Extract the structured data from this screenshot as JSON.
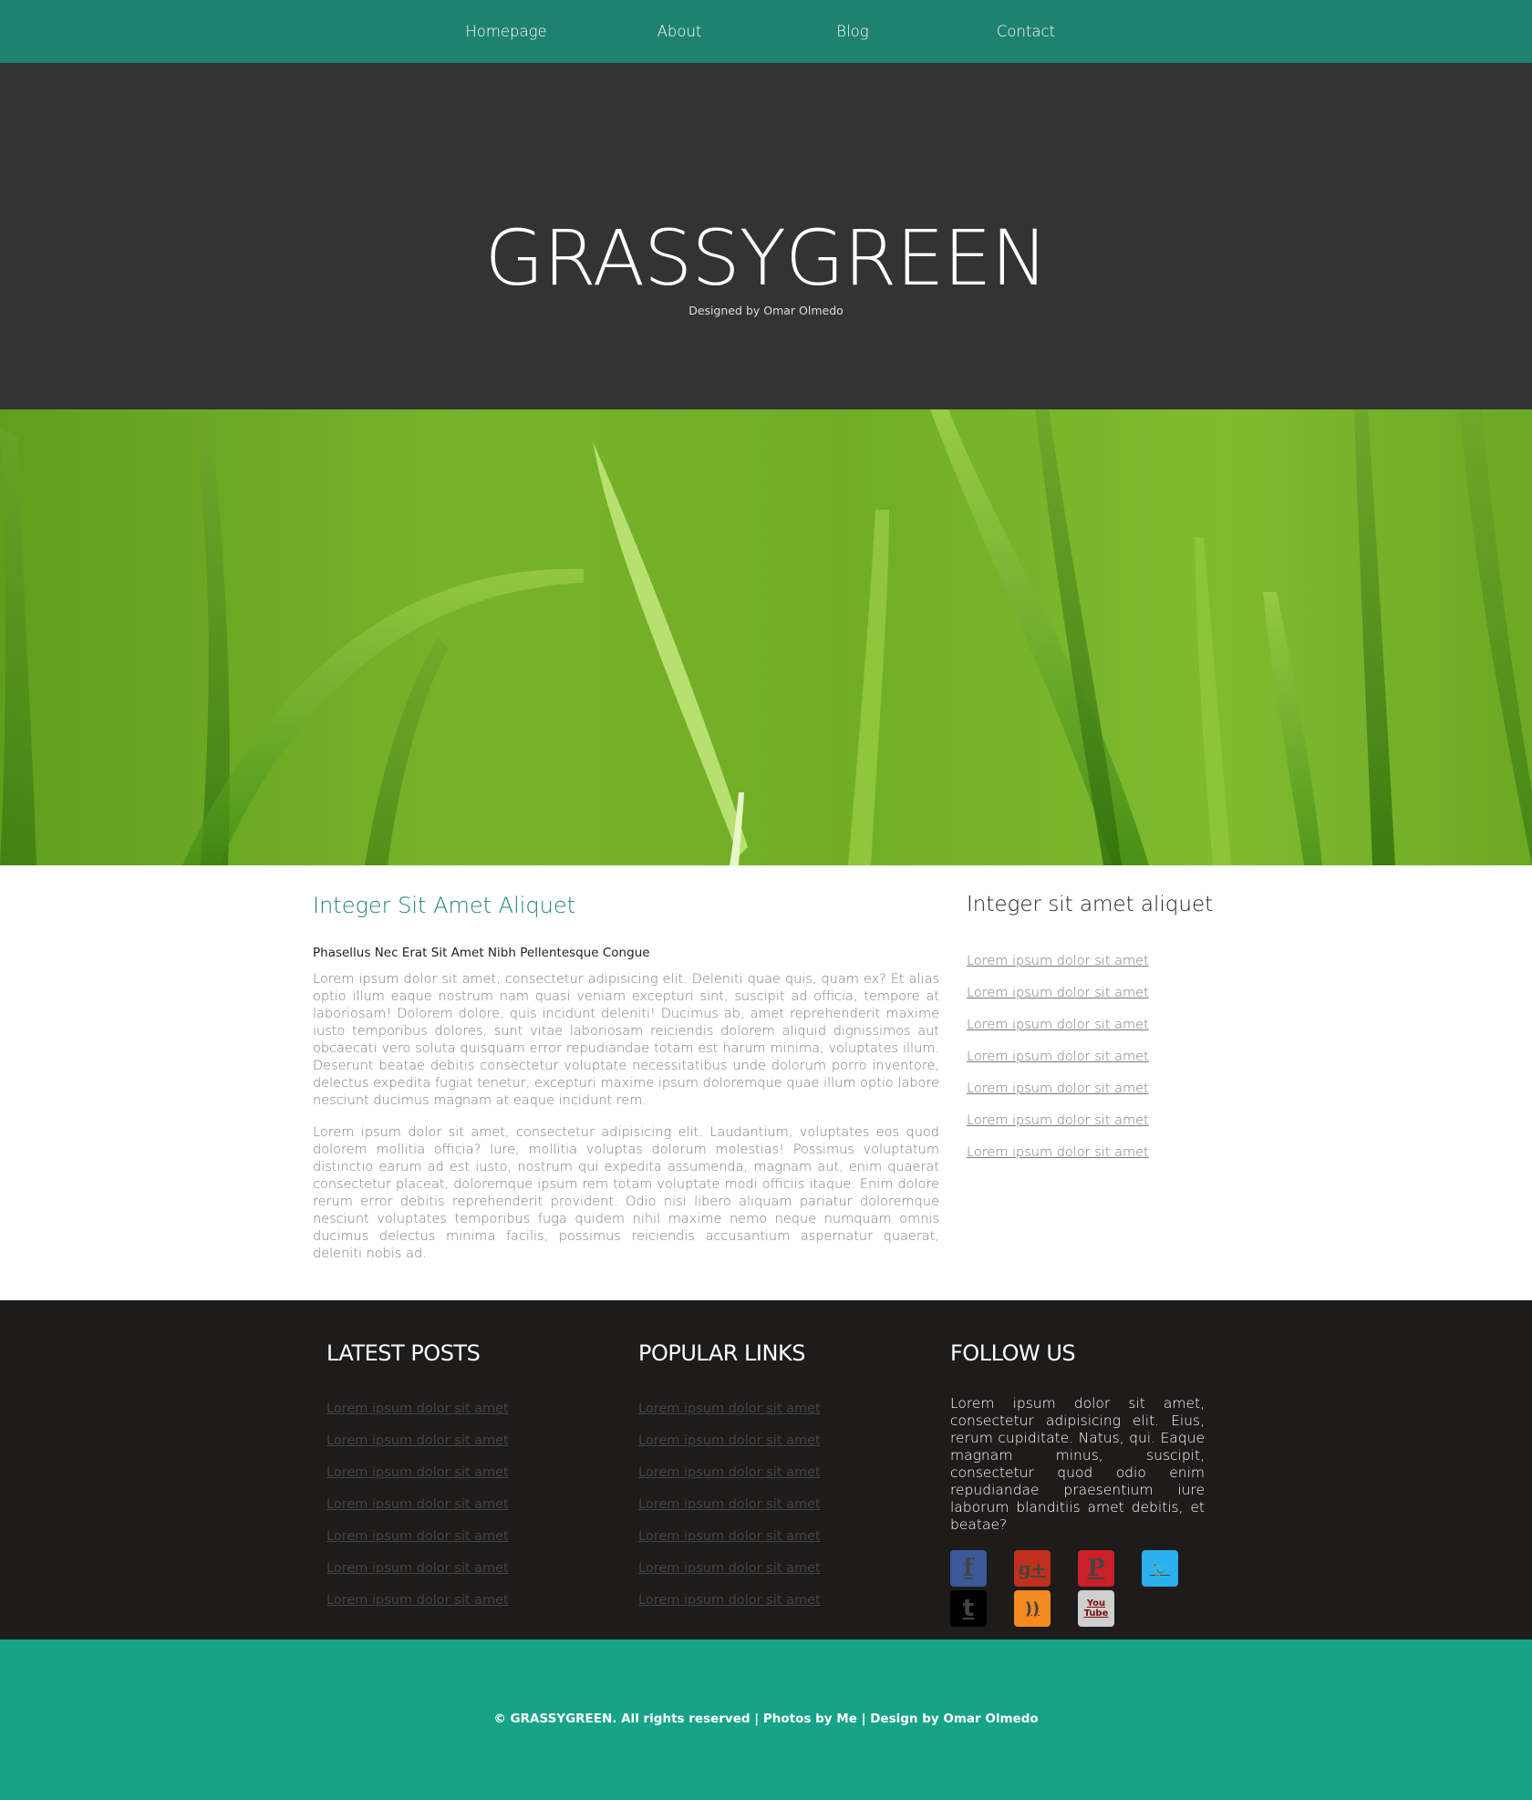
{
  "nav": {
    "items": [
      {
        "label": "Homepage"
      },
      {
        "label": "About"
      },
      {
        "label": "Blog"
      },
      {
        "label": "Contact"
      }
    ]
  },
  "header": {
    "title": "GRASSYGREEN",
    "subtitle": "Designed by Omar Olmedo"
  },
  "main": {
    "heading": "Integer Sit Amet Aliquet",
    "subheading": "Phasellus Nec Erat Sit Amet Nibh Pellentesque Congue",
    "paragraphs": [
      "Lorem ipsum dolor sit amet, consectetur adipisicing elit. Deleniti quae quis, quam ex? Et alias optio illum eaque nostrum nam quasi veniam excepturi sint, suscipit ad officia, tempore at laboriosam! Dolorem dolore, quis incidunt deleniti! Ducimus ab, amet reprehenderit maxime iusto temporibus dolores, sunt vitae laboriosam reiciendis dolorem aliquid dignissimos aut obcaecati vero soluta quisquam error repudiandae totam est harum minima, voluptates illum. Deserunt beatae debitis consectetur voluptate necessitatibus unde dolorum porro inventore, delectus expedita fugiat tenetur, excepturi maxime ipsum doloremque quae illum optio labore nesciunt ducimus magnam at eaque incidunt rem.",
      "Lorem ipsum dolor sit amet, consectetur adipisicing elit. Laudantium, voluptates eos quod dolorem mollitia officia? Iure, mollitia voluptas dolorum molestias! Possimus voluptatum distinctio earum ad est iusto, nostrum qui expedita assumenda, magnam aut, enim quaerat consectetur placeat, doloremque ipsum rem totam voluptate modi officiis itaque. Enim dolore rerum error debitis reprehenderit provident. Odio nisi libero aliquam pariatur doloremque nesciunt voluptates temporibus fuga quidem nihil maxime nemo neque numquam omnis ducimus delectus minima facilis, possimus reiciendis accusantium aspernatur quaerat, deleniti nobis ad."
    ]
  },
  "sidebar": {
    "heading": "Integer sit amet aliquet",
    "links": [
      "Lorem ipsum dolor sit amet",
      "Lorem ipsum dolor sit amet",
      "Lorem ipsum dolor sit amet",
      "Lorem ipsum dolor sit amet",
      "Lorem ipsum dolor sit amet",
      "Lorem ipsum dolor sit amet",
      "Lorem ipsum dolor sit amet"
    ]
  },
  "footer": {
    "latest_posts": {
      "heading": "LATEST POSTS",
      "links": [
        "Lorem ipsum dolor sit amet",
        "Lorem ipsum dolor sit amet",
        "Lorem ipsum dolor sit amet",
        "Lorem ipsum dolor sit amet",
        "Lorem ipsum dolor sit amet",
        "Lorem ipsum dolor sit amet",
        "Lorem ipsum dolor sit amet"
      ]
    },
    "popular_links": {
      "heading": "POPULAR LINKS",
      "links": [
        "Lorem ipsum dolor sit amet",
        "Lorem ipsum dolor sit amet",
        "Lorem ipsum dolor sit amet",
        "Lorem ipsum dolor sit amet",
        "Lorem ipsum dolor sit amet",
        "Lorem ipsum dolor sit amet",
        "Lorem ipsum dolor sit amet"
      ]
    },
    "follow_us": {
      "heading": "FOLLOW US",
      "text": "Lorem ipsum dolor sit amet, consectetur adipisicing elit. Eius, rerum cupiditate. Natus, qui. Eaque magnam minus, suscipit, consectetur quod odio enim repudiandae praesentium iure laborum blanditiis amet debitis, et beatae?",
      "icons": [
        {
          "name": "facebook-icon",
          "glyph": "f",
          "color": "#3b5998"
        },
        {
          "name": "google-plus-icon",
          "glyph": "g+",
          "color": "#c1301c"
        },
        {
          "name": "pinterest-icon",
          "glyph": "P",
          "color": "#cb2027"
        },
        {
          "name": "twitter-icon",
          "glyph": "🐦",
          "color": "#2ab0ec"
        },
        {
          "name": "tumblr-icon",
          "glyph": "t",
          "color": "#000000"
        },
        {
          "name": "rss-icon",
          "glyph": "))",
          "color": "#f58a1f"
        },
        {
          "name": "youtube-icon",
          "glyph": "You Tube",
          "color": "#cfcfcf"
        }
      ]
    }
  },
  "bottom": {
    "copyright": "© GRASSYGREEN. All rights reserved | Photos by Me | Design by Omar Olmedo"
  },
  "colors": {
    "nav_bg": "#1f8270",
    "header_bg": "#333333",
    "footer_bg": "#1e1b1b",
    "bottom_bg": "#17a387",
    "accent": "#1f8270"
  }
}
